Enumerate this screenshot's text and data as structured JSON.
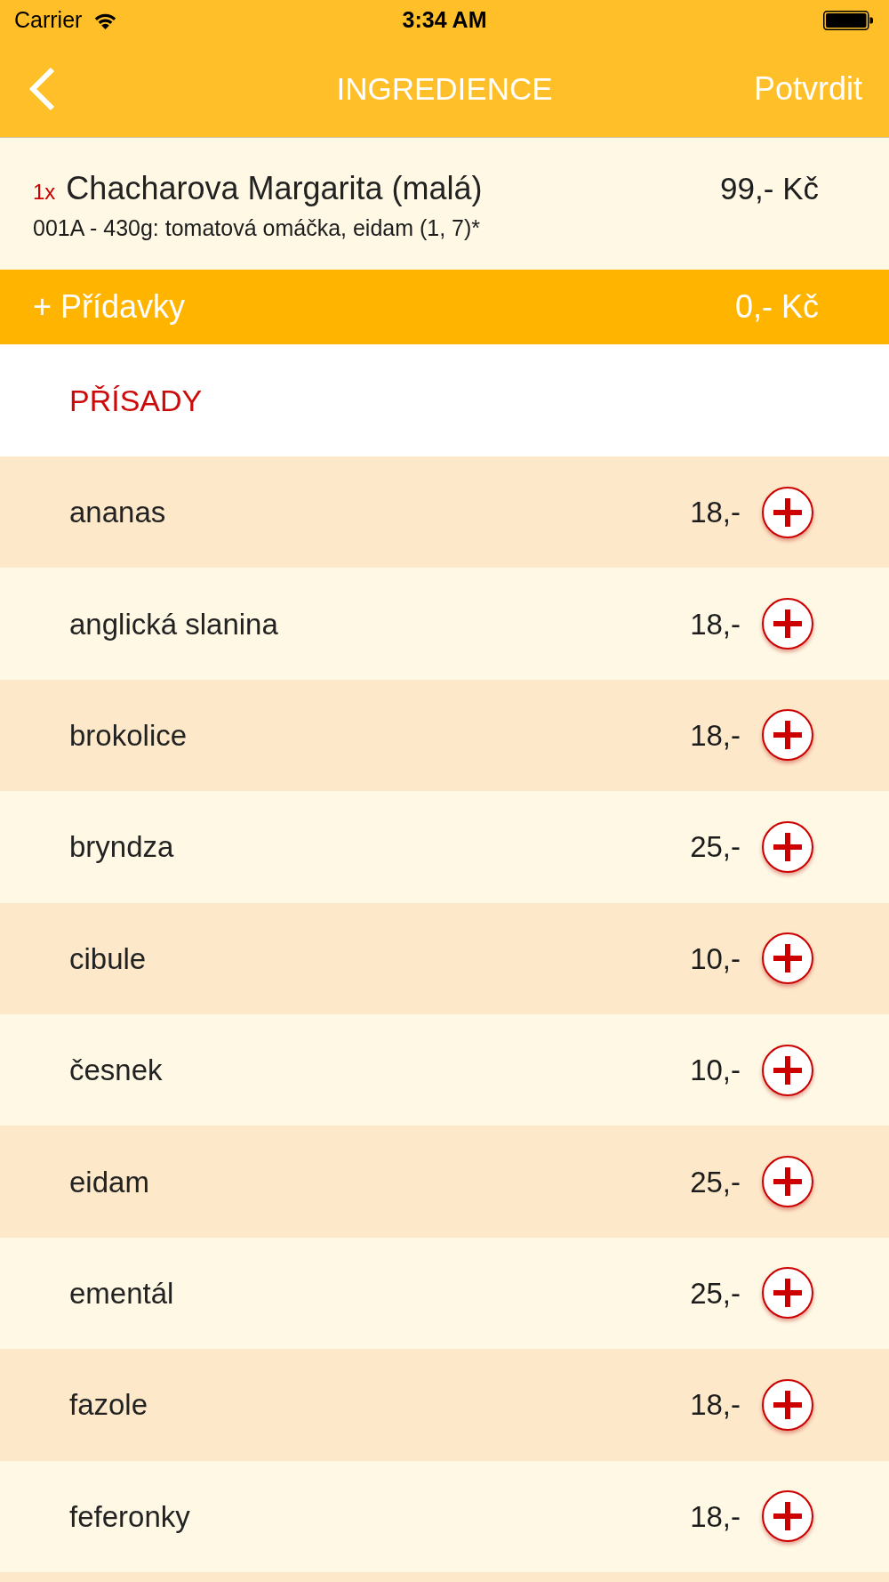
{
  "status_bar": {
    "carrier": "Carrier",
    "time": "3:34 AM"
  },
  "nav_bar": {
    "title": "INGREDIENCE",
    "action": "Potvrdit"
  },
  "product": {
    "quantity": "1x",
    "name": "Chacharova Margarita (malá)",
    "price": "99,- Kč",
    "description": "001A - 430g: tomatová omáčka, eidam (1, 7)*"
  },
  "extras_bar": {
    "label": "+ Přídavky",
    "total": "0,- Kč"
  },
  "section": {
    "title": "PŘÍSADY"
  },
  "ingredients": [
    {
      "name": "ananas",
      "price": "18,-"
    },
    {
      "name": "anglická slanina",
      "price": "18,-"
    },
    {
      "name": "brokolice",
      "price": "18,-"
    },
    {
      "name": "bryndza",
      "price": "25,-"
    },
    {
      "name": "cibule",
      "price": "10,-"
    },
    {
      "name": "česnek",
      "price": "10,-"
    },
    {
      "name": "eidam",
      "price": "25,-"
    },
    {
      "name": "ementál",
      "price": "25,-"
    },
    {
      "name": "fazole",
      "price": "18,-"
    },
    {
      "name": "feferonky",
      "price": "18,-"
    }
  ]
}
